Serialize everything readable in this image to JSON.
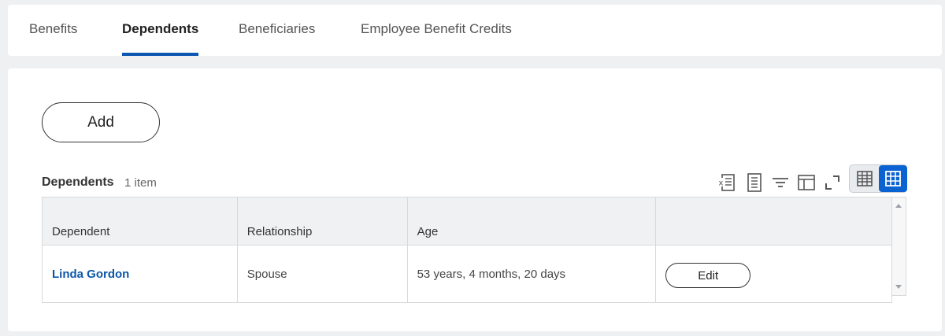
{
  "tabs": [
    {
      "label": "Benefits",
      "active": false
    },
    {
      "label": "Dependents",
      "active": true
    },
    {
      "label": "Beneficiaries",
      "active": false
    },
    {
      "label": "Employee Benefit Credits",
      "active": false
    }
  ],
  "actions": {
    "add_label": "Add"
  },
  "section": {
    "title": "Dependents",
    "count": "1 item"
  },
  "toolbar": {
    "icons": [
      "excel-export-icon",
      "print-icon",
      "filter-icon",
      "columns-icon",
      "fullscreen-icon"
    ],
    "views": [
      "table-view-icon",
      "grid-view-icon"
    ],
    "active_view": "grid-view-icon"
  },
  "table": {
    "columns": [
      "Dependent",
      "Relationship",
      "Age",
      ""
    ],
    "rows": [
      {
        "dependent": "Linda Gordon",
        "relationship": "Spouse",
        "age": "53 years, 4 months, 20 days",
        "action": "Edit"
      }
    ]
  },
  "colors": {
    "accent": "#0b56b3",
    "link": "#0b56a8",
    "active_view_bg": "#0b63d1"
  }
}
